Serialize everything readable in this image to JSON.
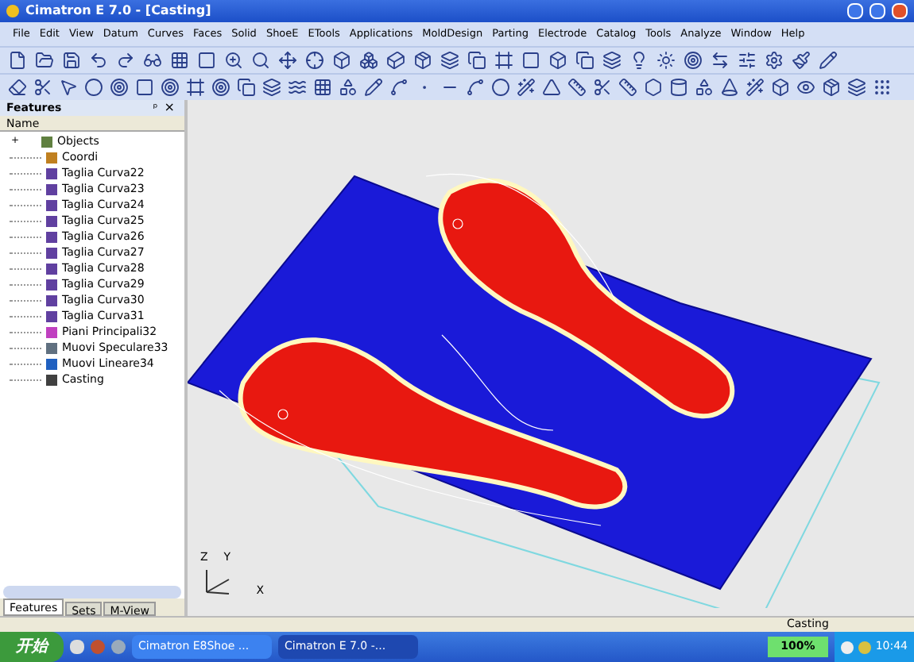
{
  "window": {
    "title": "Cimatron E 7.0 - [Casting]"
  },
  "menu": [
    "File",
    "Edit",
    "View",
    "Datum",
    "Curves",
    "Faces",
    "Solid",
    "ShoeE",
    "ETools",
    "Applications",
    "MoldDesign",
    "Parting",
    "Electrode",
    "Catalog",
    "Tools",
    "Analyze",
    "Window",
    "Help"
  ],
  "panel": {
    "title": "Features",
    "pin": "ᵖ",
    "close": "×",
    "column": "Name",
    "root": {
      "label": "Objects",
      "expander": "+",
      "expanded": false
    },
    "items": [
      {
        "label": "Coordi",
        "kind": "coord"
      },
      {
        "label": "Taglia Curva22",
        "kind": "cut"
      },
      {
        "label": "Taglia Curva23",
        "kind": "cut"
      },
      {
        "label": "Taglia Curva24",
        "kind": "cut"
      },
      {
        "label": "Taglia Curva25",
        "kind": "cut"
      },
      {
        "label": "Taglia Curva26",
        "kind": "cut"
      },
      {
        "label": "Taglia Curva27",
        "kind": "cut"
      },
      {
        "label": "Taglia Curva28",
        "kind": "cut"
      },
      {
        "label": "Taglia Curva29",
        "kind": "cut"
      },
      {
        "label": "Taglia Curva30",
        "kind": "cut"
      },
      {
        "label": "Taglia Curva31",
        "kind": "cut"
      },
      {
        "label": "Piani Principali32",
        "kind": "plane"
      },
      {
        "label": "Muovi Speculare33",
        "kind": "mirror"
      },
      {
        "label": "Muovi Lineare34",
        "kind": "move"
      },
      {
        "label": "Casting",
        "kind": "part"
      }
    ],
    "tabs": [
      {
        "label": "Features",
        "selected": true
      },
      {
        "label": "Sets",
        "selected": false
      },
      {
        "label": "M-View",
        "selected": false
      }
    ]
  },
  "axes": {
    "x": "X",
    "y": "Y",
    "z": "Z"
  },
  "status_bar": {
    "text": "Casting"
  },
  "taskbar": {
    "start": "开始",
    "tasks": [
      {
        "label": "Cimatron E8Shoe ...",
        "selected": false
      },
      {
        "label": "Cimatron E 7.0 -...",
        "selected": true
      }
    ],
    "zoom": "100%",
    "time": "10:44"
  }
}
